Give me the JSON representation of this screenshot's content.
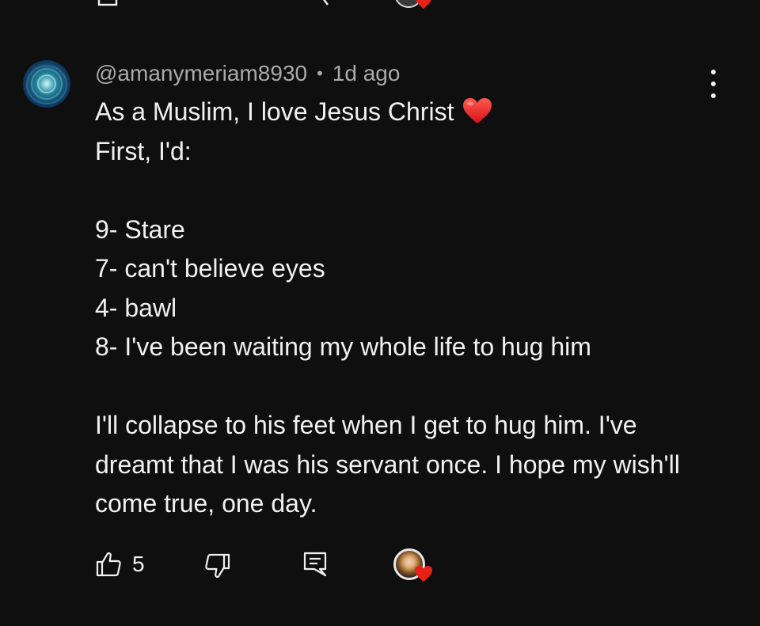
{
  "comment": {
    "author": "@amanymeriam8930",
    "separator": "•",
    "time": "1d ago",
    "lines": [
      "As a Muslim, I love Jesus Christ",
      "First, I'd:",
      "9- Stare",
      "7- can't believe eyes",
      "4- bawl",
      "8- I've been waiting my whole life to hug him",
      "I'll collapse to his feet when I get to hug him. I've dreamt that I was his servant once. I hope my wish'll come true, one day."
    ],
    "emoji": "red-heart"
  },
  "actions": {
    "like_count": "5",
    "like_icon": "thumbs-up-icon",
    "dislike_icon": "thumbs-down-icon",
    "reply_icon": "reply-icon",
    "creator_heart": "red-heart"
  },
  "colors": {
    "background": "#0f0f0f",
    "text": "#f1f1f1",
    "secondary_text": "#aaaaaa",
    "heart": "#e62117"
  }
}
